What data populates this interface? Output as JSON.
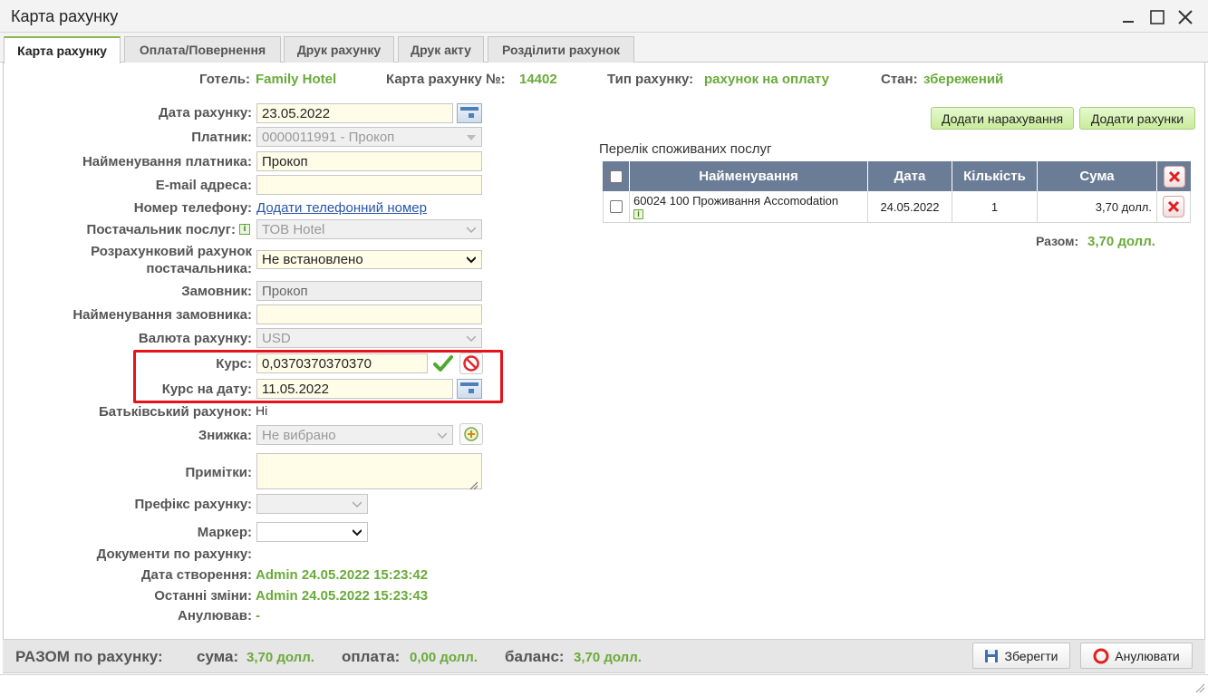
{
  "window": {
    "title": "Карта рахунку"
  },
  "tabs": [
    {
      "label": "Карта рахунку"
    },
    {
      "label": "Оплата/Повернення"
    },
    {
      "label": "Друк рахунку"
    },
    {
      "label": "Друк акту"
    },
    {
      "label": "Розділити рахунок"
    }
  ],
  "header": {
    "hotel_label": "Готель:",
    "hotel_value": "Family Hotel",
    "card_label": "Карта рахунку №:",
    "card_value": "14402",
    "type_label": "Тип рахунку:",
    "type_value": "рахунок на оплату",
    "state_label": "Стан:",
    "state_value": "збережений"
  },
  "form": {
    "invoice_date_label": "Дата рахунку:",
    "invoice_date_value": "23.05.2022",
    "payer_label": "Платник:",
    "payer_value": "0000011991 - Прокоп",
    "payer_name_label": "Найменування платника:",
    "payer_name_value": "Прокоп",
    "email_label": "E-mail адреса:",
    "email_value": "",
    "phone_label": "Номер телефону:",
    "phone_link": "Додати телефонний номер",
    "supplier_label": "Постачальник послуг:",
    "supplier_value": "ТОВ Hotel",
    "account_label_1": "Розрахунковий рахунок",
    "account_label_2": "постачальника:",
    "account_value": "Не встановлено",
    "customer_label": "Замовник:",
    "customer_value": "Прокоп",
    "customer_name_label": "Найменування замовника:",
    "customer_name_value": "",
    "currency_label": "Валюта рахунку:",
    "currency_value": "USD",
    "rate_label": "Курс:",
    "rate_value": "0,0370370370370",
    "rate_date_label": "Курс на дату:",
    "rate_date_value": "11.05.2022",
    "parent_label": "Батьківський рахунок:",
    "parent_value": "Ні",
    "discount_label": "Знижка:",
    "discount_value": "Не вибрано",
    "notes_label": "Примітки:",
    "notes_value": "",
    "prefix_label": "Префікс рахунку:",
    "prefix_value": "",
    "marker_label": "Маркер:",
    "marker_value": "",
    "docs_label": "Документи по рахунку:",
    "created_label": "Дата створення:",
    "created_value": "Admin 24.05.2022 15:23:42",
    "modified_label": "Останні зміни:",
    "modified_value": "Admin 24.05.2022 15:23:43",
    "cancelled_label": "Анулював:",
    "cancelled_value": "-"
  },
  "services": {
    "add_charge_button": "Додати нарахування",
    "add_invoices_button": "Додати рахунки",
    "title": "Перелік споживаних послуг",
    "columns": [
      "Найменування",
      "Дата",
      "Кількість",
      "Сума"
    ],
    "rows": [
      {
        "name": "60024 100 Проживання Accomodation",
        "date": "24.05.2022",
        "qty": "1",
        "sum": "3,70 долл."
      }
    ],
    "total_label": "Разом:",
    "total_value": "3,70 долл."
  },
  "footer": {
    "total_label": "РАЗОМ по рахунку:",
    "sum_label": "сума:",
    "sum_value": "3,70 долл.",
    "payment_label": "оплата:",
    "payment_value": "0,00 долл.",
    "balance_label": "баланс:",
    "balance_value": "3,70 долл.",
    "save_button": "Зберегти",
    "cancel_button": "Анулювати"
  },
  "colors": {
    "accent_green": "#6aaa3a",
    "table_header": "#6b7d96",
    "highlight": "#e5141a"
  }
}
